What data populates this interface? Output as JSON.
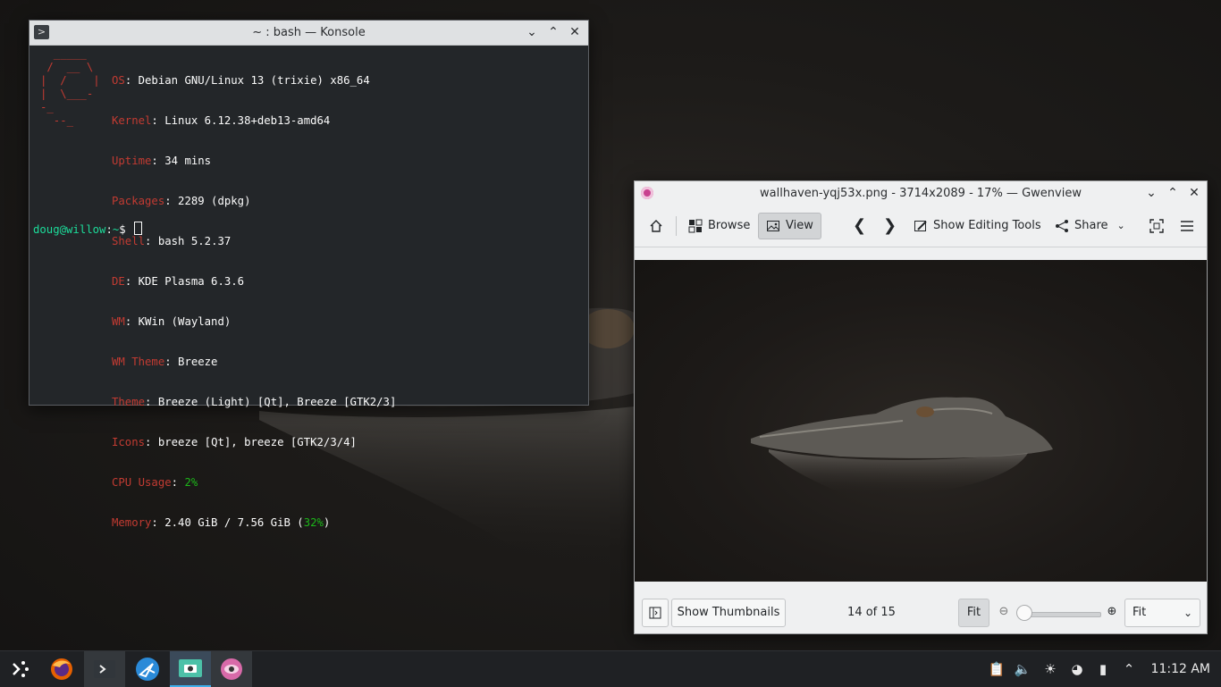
{
  "konsole": {
    "title": "~ : bash — Konsole",
    "logo": "  _____\n /  __ \\\n|  /    |\n|  \\___-\n-_\n  --_",
    "info": [
      {
        "key": "OS",
        "value": ": Debian GNU/Linux 13 (trixie) x86_64"
      },
      {
        "key": "Kernel",
        "value": ": Linux 6.12.38+deb13-amd64"
      },
      {
        "key": "Uptime",
        "value": ": 34 mins"
      },
      {
        "key": "Packages",
        "value": ": 2289 (dpkg)"
      },
      {
        "key": "Shell",
        "value": ": bash 5.2.37"
      },
      {
        "key": "DE",
        "value": ": KDE Plasma 6.3.6"
      },
      {
        "key": "WM",
        "value": ": KWin (Wayland)"
      },
      {
        "key": "WM Theme",
        "value": ": Breeze"
      },
      {
        "key": "Theme",
        "value": ": Breeze (Light) [Qt], Breeze [GTK2/3]"
      },
      {
        "key": "Icons",
        "value": ": breeze [Qt], breeze [GTK2/3/4]"
      }
    ],
    "cpu": {
      "key": "CPU Usage",
      "sep": ": ",
      "value": "2%"
    },
    "memory": {
      "key": "Memory",
      "pre": ": 2.40 GiB / 7.56 GiB (",
      "pct": "32%",
      "post": ")"
    },
    "prompt": {
      "user": "doug@willow",
      "sep": ":",
      "path": "~",
      "symbol": "$ "
    }
  },
  "gwenview": {
    "title": "wallhaven-yqj53x.png - 3714x2089 - 17% — Gwenview",
    "toolbar": {
      "browse": "Browse",
      "view": "View",
      "editing": "Show Editing Tools",
      "share": "Share"
    },
    "status": {
      "thumbnails": "Show Thumbnails",
      "position": "14 of 15",
      "fit_button": "Fit",
      "zoom_select": "Fit",
      "zoom_fraction": 0.0
    }
  },
  "taskbar": {
    "tasks": [
      "launcher-icon",
      "firefox-icon",
      "konsole-icon",
      "discover-icon",
      "spectacle-icon",
      "gwenview-icon"
    ],
    "clock": "11:12 AM"
  }
}
